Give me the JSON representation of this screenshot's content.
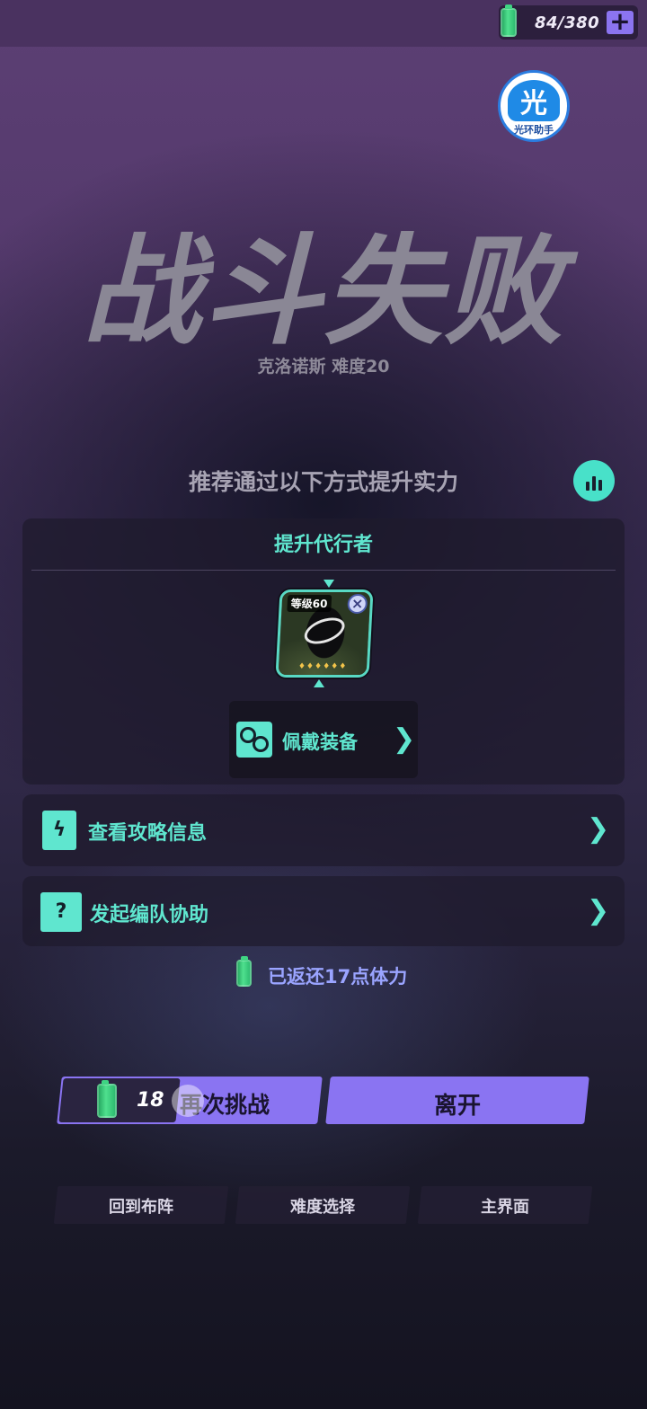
{
  "topbar": {
    "energy_text": "84/380",
    "add_icon": "plus-icon"
  },
  "assistant": {
    "glyph": "光",
    "label": "光环助手"
  },
  "result": {
    "title": "战斗失败",
    "subtitle": "克洛诺斯 难度20"
  },
  "recommend": {
    "text": "推荐通过以下方式提升实力",
    "stats_icon": "bar-chart-icon"
  },
  "upgrade": {
    "title": "提升代行者",
    "agent_card": {
      "level": "等级60",
      "stars": "♦♦♦♦♦♦"
    },
    "equip_label": "佩戴装备"
  },
  "options": [
    {
      "label": "查看攻略信息",
      "icon": "lightning-book-icon"
    },
    {
      "label": "发起编队协助",
      "icon": "question-cards-icon",
      "icon_text": "?"
    }
  ],
  "refund": {
    "text": "已返还17点体力"
  },
  "actions": {
    "retry_cost": "18",
    "retry_label": "再次挑战",
    "leave_label": "离开"
  },
  "nav": [
    {
      "label": "回到布阵"
    },
    {
      "label": "难度选择"
    },
    {
      "label": "主界面"
    }
  ],
  "colors": {
    "accent_teal": "#5fe6cf",
    "accent_purple": "#8a74f2",
    "refund_blue": "#9aa4ff"
  }
}
